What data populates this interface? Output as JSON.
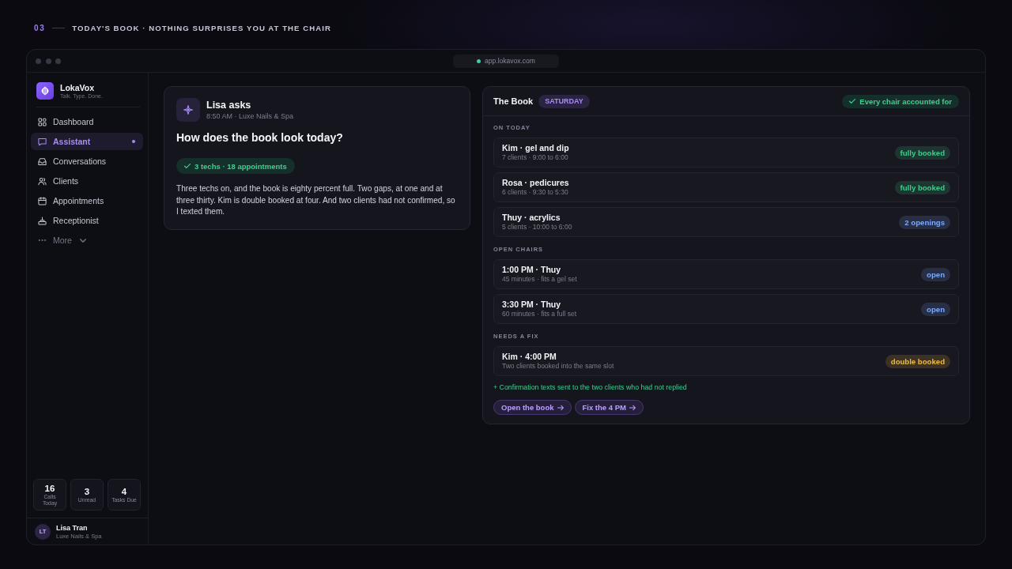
{
  "header": {
    "step": "03",
    "title": "TODAY'S BOOK · NOTHING SURPRISES YOU AT THE CHAIR"
  },
  "browser": {
    "url": "app.lokavox.com"
  },
  "sidebar": {
    "brand": {
      "name": "LokaVox",
      "tagline": "Talk. Type. Done."
    },
    "items": [
      {
        "label": "Dashboard",
        "selected": false
      },
      {
        "label": "Assistant",
        "selected": true
      },
      {
        "label": "Conversations",
        "selected": false
      },
      {
        "label": "Clients",
        "selected": false
      },
      {
        "label": "Appointments",
        "selected": false
      },
      {
        "label": "Receptionist",
        "selected": false
      }
    ],
    "more": "More",
    "stats": [
      {
        "value": "16",
        "label": "Calls Today"
      },
      {
        "value": "3",
        "label": "Unread"
      },
      {
        "value": "4",
        "label": "Tasks Due"
      }
    ],
    "user": {
      "initials": "LT",
      "name": "Lisa Tran",
      "business": "Luxe Nails & Spa"
    }
  },
  "question_card": {
    "asker": "Lisa asks",
    "meta": "8:50 AM · Luxe Nails & Spa",
    "question": "How does the book look today?",
    "summary": "3 techs · 18 appointments",
    "answer": "Three techs on, and the book is eighty percent full. Two gaps, at one and at three thirty. Kim is double booked at four. And two clients had not confirmed, so I texted them."
  },
  "book_card": {
    "title": "The Book",
    "day": "SATURDAY",
    "status": "Every chair accounted for",
    "sections": [
      {
        "label": "ON TODAY",
        "rows": [
          {
            "title": "Kim · gel and dip",
            "detail": "7 clients · 9:00 to 6:00",
            "badge": "fully booked",
            "color": "#1e3532"
          },
          {
            "title": "Rosa · pedicures",
            "detail": "6 clients · 9:30 to 5:30",
            "badge": "fully booked",
            "color": "#1e3532"
          },
          {
            "title": "Thuy · acrylics",
            "detail": "5 clients · 10:00 to 6:00",
            "badge": "2 openings",
            "color": "#282f45"
          }
        ]
      },
      {
        "label": "OPEN CHAIRS",
        "rows": [
          {
            "title": "1:00 PM · Thuy",
            "detail": "45 minutes · fits a gel set",
            "badge": "open",
            "color": "#282f45"
          },
          {
            "title": "3:30 PM · Thuy",
            "detail": "60 minutes · fits a full set",
            "badge": "open",
            "color": "#282f45"
          }
        ]
      },
      {
        "label": "NEEDS A FIX",
        "rows": [
          {
            "title": "Kim · 4:00 PM",
            "detail": "Two clients booked into the same slot",
            "badge": "double booked",
            "color": "#3b3225"
          }
        ]
      }
    ],
    "note": "+ Confirmation texts sent to the two clients who had not replied",
    "actions": [
      {
        "label": "Open the book"
      },
      {
        "label": "Fix the 4 PM"
      }
    ]
  }
}
